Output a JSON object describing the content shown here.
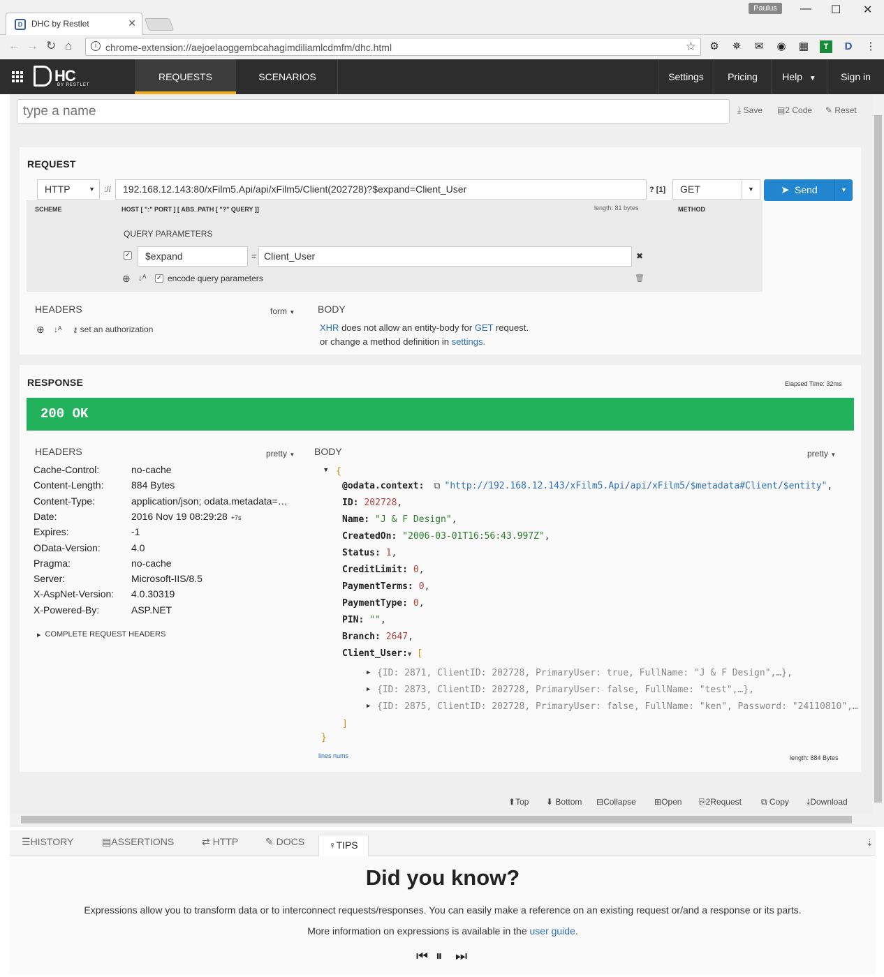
{
  "browser": {
    "tab_title": "DHC by Restlet",
    "user": "Paulus",
    "url": "chrome-extension://aejoelaoggembcahagimdiliamlcdmfm/dhc.html"
  },
  "appbar": {
    "logo_main": "HC",
    "logo_sub": "BY RESTLET",
    "nav": {
      "requests": "REQUESTS",
      "scenarios": "SCENARIOS"
    },
    "right": {
      "settings": "Settings",
      "pricing": "Pricing",
      "help": "Help",
      "signin": "Sign in"
    }
  },
  "name_bar": {
    "placeholder": "type a name",
    "save": "Save",
    "code": "2 Code",
    "reset": "Reset"
  },
  "request": {
    "title": "REQUEST",
    "scheme": "HTTP",
    "sep": "://",
    "url": "192.168.12.143:80/xFilm5.Api/api/xFilm5/Client(202728)?$expand=Client_User",
    "query_count": "? [1]",
    "method": "GET",
    "send": "Send",
    "scheme_label": "SCHEME",
    "host_label": "HOST [ \":\" PORT ] [ ABS_PATH [ \"?\" QUERY ]]",
    "length": "length: 81 bytes",
    "method_label": "METHOD",
    "query_params_label": "QUERY PARAMETERS",
    "param_name": "$expand",
    "param_eq": "=",
    "param_value": "Client_User",
    "encode_label": "encode query parameters",
    "headers_label": "HEADERS",
    "form_label": "form",
    "auth_label": "set an authorization",
    "body_label": "BODY",
    "body_msg_xhr": "XHR",
    "body_msg_1": " does not allow an entity-body for ",
    "body_msg_get": "GET",
    "body_msg_2": " request.",
    "body_msg_3": "or change a method definition in ",
    "body_msg_settings": "settings."
  },
  "response": {
    "title": "RESPONSE",
    "elapsed": "Elapsed Time: 32ms",
    "status": "200 OK",
    "headers_label": "HEADERS",
    "pretty": "pretty",
    "body_label": "BODY",
    "headers": [
      {
        "name": "Cache-Control:",
        "value": "no-cache"
      },
      {
        "name": "Content-Length:",
        "value": "884 Bytes"
      },
      {
        "name": "Content-Type:",
        "value": "application/json; odata.metadata=…"
      },
      {
        "name": "Date:",
        "value": "2016 Nov 19 08:29:28",
        "extra": "+7s"
      },
      {
        "name": "Expires:",
        "value": "-1"
      },
      {
        "name": "OData-Version:",
        "value": "4.0"
      },
      {
        "name": "Pragma:",
        "value": "no-cache"
      },
      {
        "name": "Server:",
        "value": "Microsoft-IIS/8.5"
      },
      {
        "name": "X-AspNet-Version:",
        "value": "4.0.30319"
      },
      {
        "name": "X-Powered-By:",
        "value": "ASP.NET"
      }
    ],
    "complete_headers": "COMPLETE REQUEST HEADERS",
    "json": {
      "odata_context_key": "@odata.context:",
      "odata_context_val": "\"http://192.168.12.143/xFilm5.Api/api/xFilm5/$metadata#Client/$entity\"",
      "fields": [
        {
          "key": "ID:",
          "val": "202728",
          "type": "num"
        },
        {
          "key": "Name:",
          "val": "\"J & F Design\"",
          "type": "str"
        },
        {
          "key": "CreatedOn:",
          "val": "\"2006-03-01T16:56:43.997Z\"",
          "type": "str"
        },
        {
          "key": "Status:",
          "val": "1",
          "type": "num"
        },
        {
          "key": "CreditLimit:",
          "val": "0",
          "type": "num"
        },
        {
          "key": "PaymentTerms:",
          "val": "0",
          "type": "num"
        },
        {
          "key": "PaymentType:",
          "val": "0",
          "type": "num"
        },
        {
          "key": "PIN:",
          "val": "\"\"",
          "type": "str"
        },
        {
          "key": "Branch:",
          "val": "2647",
          "type": "num"
        }
      ],
      "client_user_key": "Client_User:",
      "items": [
        "{ID:  2871, ClientID:  202728, PrimaryUser:  true, FullName:  \"J & F Design\",…},",
        "{ID:  2873, ClientID:  202728, PrimaryUser:  false, FullName:  \"test\",…},",
        "{ID:  2875, ClientID:  202728, PrimaryUser:  false, FullName:  \"ken\", Password:  \"24110810\",…"
      ]
    },
    "lines_nums": "lines nums",
    "length": "length: 884 Bytes"
  },
  "body_actions": {
    "top": "Top",
    "bottom": "Bottom",
    "collapse": "Collapse",
    "open": "Open",
    "to_request": "2Request",
    "copy": "Copy",
    "download": "Download"
  },
  "bottom_tabs": {
    "history": "HISTORY",
    "assertions": "ASSERTIONS",
    "http": "HTTP",
    "docs": "DOCS",
    "tips": "TIPS"
  },
  "tips": {
    "title": "Did you know?",
    "text1": "Expressions allow you to transform data or to interconnect requests/responses. You can easily make a reference on an existing request or/and a response or its parts.",
    "text2": "More information on expressions is available in the ",
    "link": "user guide",
    "dot": "."
  },
  "colors": {
    "accent": "#2185d0",
    "status_ok": "#21b25b",
    "appbar": "#2d2d2d",
    "active_tab_underline": "#f0ad1b"
  }
}
